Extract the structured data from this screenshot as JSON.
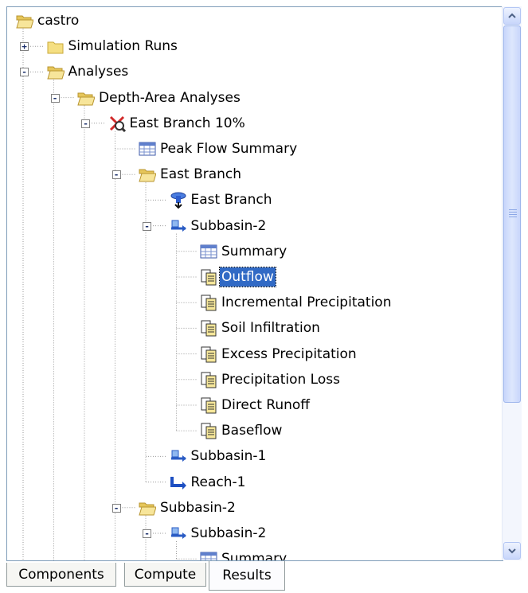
{
  "tree": {
    "nodes": [
      {
        "label": "castro",
        "icon": "folder-open-icon",
        "level": 0,
        "toggle": ""
      },
      {
        "label": "Simulation Runs",
        "icon": "folder-icon",
        "level": 1,
        "toggle": "+"
      },
      {
        "label": "Analyses",
        "icon": "folder-open-icon",
        "level": 1,
        "toggle": "-"
      },
      {
        "label": "Depth-Area Analyses",
        "icon": "folder-open-icon",
        "level": 2,
        "toggle": "-"
      },
      {
        "label": "East Branch 10%",
        "icon": "analysis-icon",
        "level": 3,
        "toggle": "-"
      },
      {
        "label": "Peak Flow Summary",
        "icon": "table-icon",
        "level": 4,
        "toggle": ""
      },
      {
        "label": "East Branch",
        "icon": "folder-open-icon",
        "level": 4,
        "toggle": "-"
      },
      {
        "label": "East Branch",
        "icon": "sink-icon",
        "level": 5,
        "toggle": ""
      },
      {
        "label": "Subbasin-2",
        "icon": "subbasin-icon",
        "level": 5,
        "toggle": "-"
      },
      {
        "label": "Summary",
        "icon": "table-icon",
        "level": 6,
        "toggle": ""
      },
      {
        "label": "Outflow",
        "icon": "time-series-icon",
        "level": 6,
        "toggle": "",
        "selected": true
      },
      {
        "label": "Incremental Precipitation",
        "icon": "time-series-icon",
        "level": 6,
        "toggle": ""
      },
      {
        "label": "Soil Infiltration",
        "icon": "time-series-icon",
        "level": 6,
        "toggle": ""
      },
      {
        "label": "Excess Precipitation",
        "icon": "time-series-icon",
        "level": 6,
        "toggle": ""
      },
      {
        "label": "Precipitation Loss",
        "icon": "time-series-icon",
        "level": 6,
        "toggle": ""
      },
      {
        "label": "Direct Runoff",
        "icon": "time-series-icon",
        "level": 6,
        "toggle": ""
      },
      {
        "label": "Baseflow",
        "icon": "time-series-icon",
        "level": 6,
        "toggle": ""
      },
      {
        "label": "Subbasin-1",
        "icon": "subbasin-icon",
        "level": 5,
        "toggle": ""
      },
      {
        "label": "Reach-1",
        "icon": "reach-icon",
        "level": 5,
        "toggle": ""
      },
      {
        "label": "Subbasin-2",
        "icon": "folder-open-icon",
        "level": 4,
        "toggle": "-"
      },
      {
        "label": "Subbasin-2",
        "icon": "subbasin-icon",
        "level": 5,
        "toggle": "-"
      },
      {
        "label": "Summary",
        "icon": "table-icon",
        "level": 6,
        "toggle": ""
      }
    ]
  },
  "tabs": [
    {
      "label": "Components",
      "active": false
    },
    {
      "label": "Compute",
      "active": false
    },
    {
      "label": "Results",
      "active": true
    }
  ],
  "colors": {
    "selection": "#316ac5",
    "folder": "#f5df82",
    "border": "#7f9db9"
  }
}
